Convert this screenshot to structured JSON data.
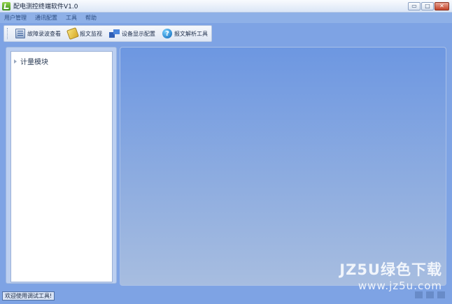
{
  "window": {
    "title": "配电测控终端软件V1.0",
    "minimize": "▭",
    "restore": "□",
    "close": "✕"
  },
  "menu": [
    "用户管理",
    "通讯配置",
    "工具",
    "帮助"
  ],
  "toolbar": {
    "buttons": [
      "故障录波查看",
      "报文监视",
      "设备显示配置",
      "报文解析工具"
    ]
  },
  "tree": {
    "items": [
      "计量模块"
    ]
  },
  "status": {
    "text": "欢迎使用调试工具!"
  },
  "watermark": {
    "line1": "JZ5U绿色下载",
    "line2": "www.jz5u.com"
  },
  "colors": {
    "background": "#7ea3e4",
    "menubar": "#8eb0e7",
    "main_top": "#6d97e1",
    "main_bottom": "#a7bde0"
  }
}
